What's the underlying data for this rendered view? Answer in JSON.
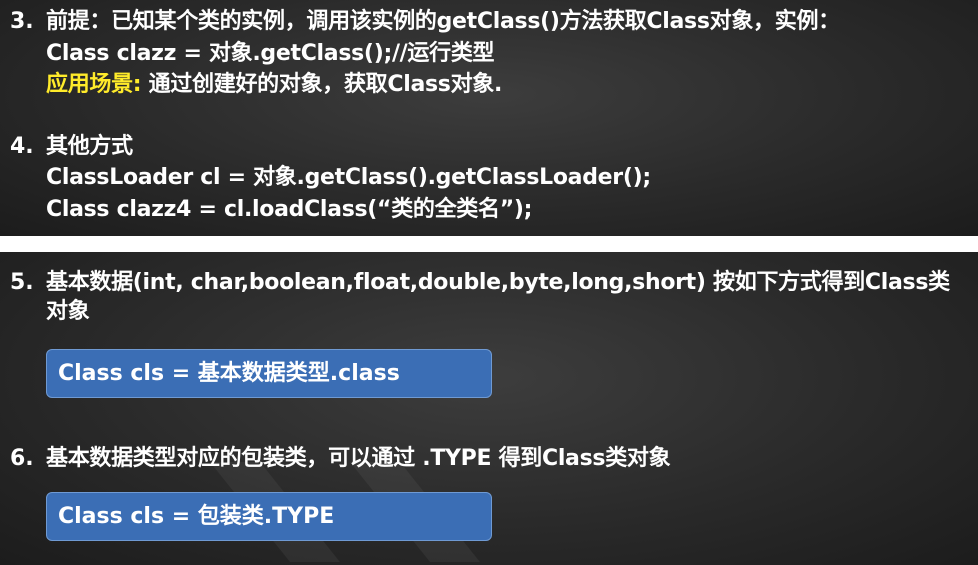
{
  "section3": {
    "number": "3.",
    "line1": "前提：已知某个类的实例，调用该实例的getClass()方法获取Class对象，实例：",
    "line2": "Class clazz =  对象.getClass();//运行类型",
    "scenario_label": "应用场景:",
    "scenario_text": " 通过创建好的对象，获取Class对象."
  },
  "section4": {
    "number": "4.",
    "title": "其他方式",
    "line1": "ClassLoader cl = 对象.getClass().getClassLoader();",
    "line2": "Class clazz4 = cl.loadClass(“类的全类名”);"
  },
  "section5": {
    "number": "5.",
    "line1": "基本数据(int, char,boolean,float,double,byte,long,short) 按如下方式得到Class类",
    "line2": "对象",
    "code": "Class cls = 基本数据类型.class"
  },
  "section6": {
    "number": "6.",
    "line1": "基本数据类型对应的包装类，可以通过 .TYPE 得到Class类对象",
    "code": "Class cls = 包装类.TYPE"
  },
  "colors": {
    "background": "#2a2a2a",
    "highlight": "#ffeb2a",
    "code_box": "#3b6eb5"
  }
}
